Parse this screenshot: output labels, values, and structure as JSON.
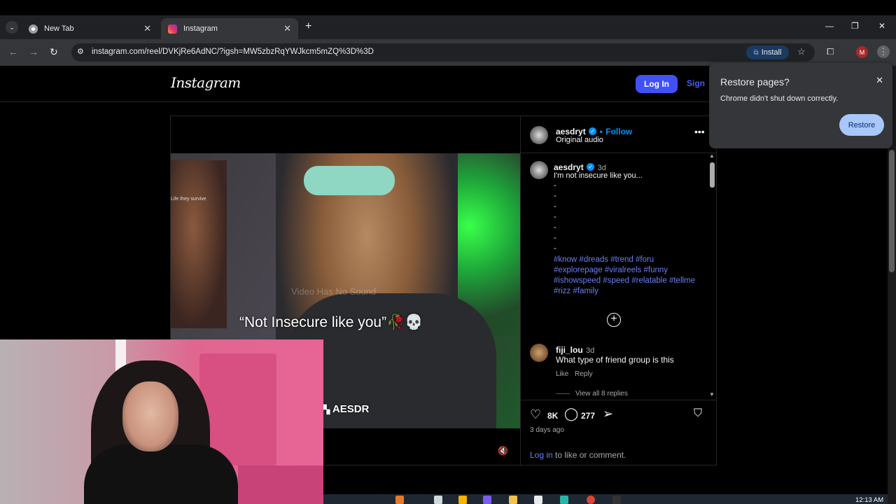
{
  "browser": {
    "tabs": [
      {
        "label": "New Tab",
        "active": false
      },
      {
        "label": "Instagram",
        "active": true
      }
    ],
    "new_tab_symbol": "+",
    "close_symbol": "✕",
    "url": "instagram.com/reel/DVKjRe6AdNC/?igsh=MW5zbzRqYWJkcm5mZQ%3D%3D",
    "install_label": "Install",
    "profile_initial": "M",
    "window_controls": [
      "—",
      "❐",
      "✕"
    ]
  },
  "restore_popup": {
    "title": "Restore pages?",
    "message": "Chrome didn't shut down correctly.",
    "button": "Restore"
  },
  "instagram": {
    "logo": "Instagram",
    "login": "Log In",
    "signup": "Sign Up",
    "post": {
      "author": "aesdryt",
      "follow": "Follow",
      "separator": "•",
      "audio": "Original audio",
      "caption_time": "3d",
      "caption": "I'm not insecure like you...",
      "dashes": [
        "-",
        "-",
        "-",
        "-",
        "-",
        "-",
        "-"
      ],
      "hashtags": "#know #dreads #trend #foru #explorepage #viralreels #funny #ishowspeed #speed #relatable #tellme #rizz #family",
      "comment": {
        "author": "fiji_lou",
        "time": "3d",
        "text": "What type of friend group is this",
        "like": "Like",
        "reply": "Reply",
        "view_replies": "View all 8 replies"
      },
      "likes": "8K",
      "comments": "277",
      "posted": "3 days ago",
      "login_link": "Log in",
      "login_prompt": " to like or comment."
    },
    "video": {
      "caption": "“Not Insecure like you”🥀💀",
      "watermark": "Video Has No Sound",
      "twitch_handle": "AESDR",
      "overlay_small": "Life they survive"
    }
  },
  "taskbar": {
    "time": "12:13 AM"
  }
}
